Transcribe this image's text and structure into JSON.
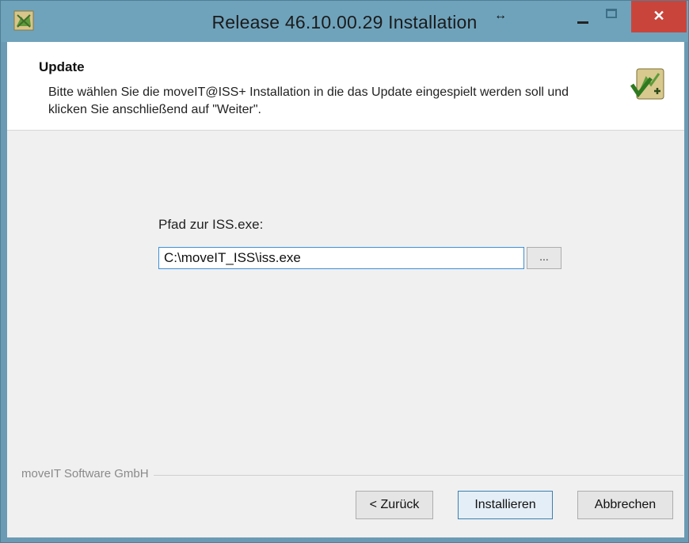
{
  "window": {
    "title": "Release 46.10.00.29 Installation",
    "resize_glyph": "↔",
    "close_glyph": "✕",
    "icons": {
      "app": "app-logo-icon",
      "resize": "resize-arrows-icon"
    }
  },
  "header": {
    "title": "Update",
    "description": "Bitte wählen Sie die moveIT@ISS+ Installation in die das Update eingespielt werden soll und klicken Sie anschließend auf \"Weiter\".",
    "icon": "update-logo-icon"
  },
  "form": {
    "path_label": "Pfad zur ISS.exe:",
    "path_value": "C:\\moveIT_ISS\\iss.exe",
    "browse_label": "..."
  },
  "footer": {
    "company": "moveIT Software GmbH",
    "back_label": "< Zurück",
    "install_label": "Installieren",
    "cancel_label": "Abbrechen"
  },
  "colors": {
    "titlebar": "#6fa3bc",
    "close_button": "#c9453c",
    "focus_border": "#3e8fd6"
  }
}
